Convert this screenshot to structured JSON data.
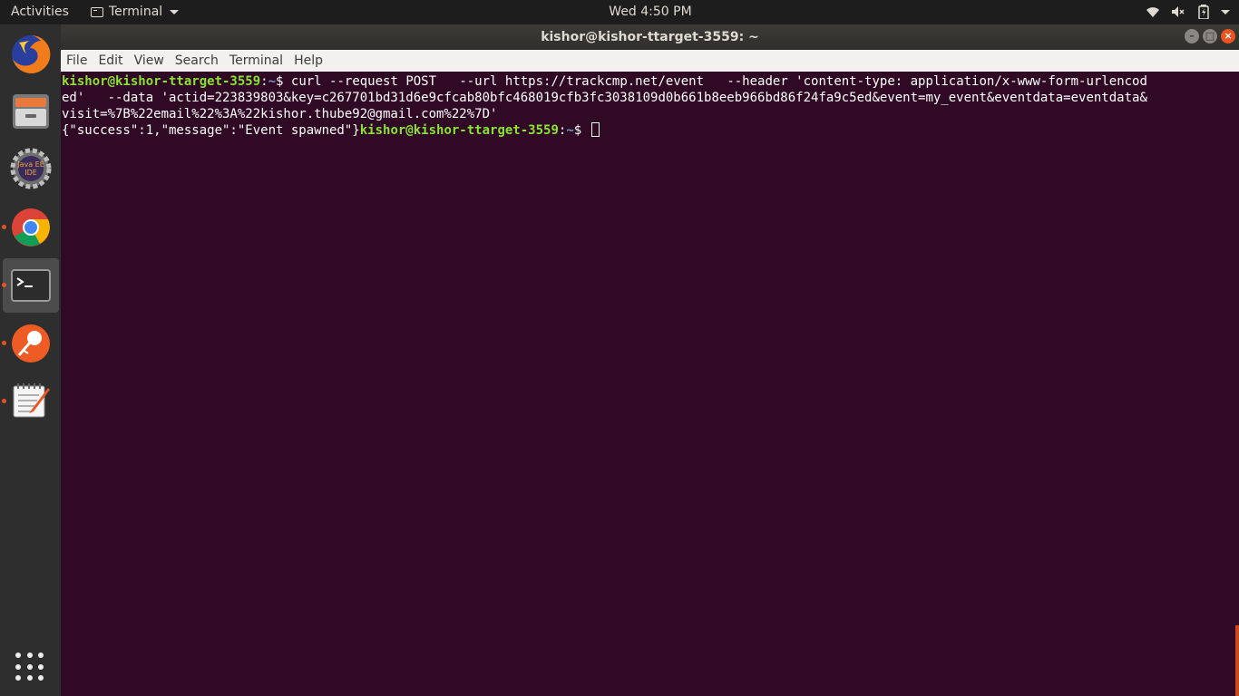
{
  "topbar": {
    "activities": "Activities",
    "app_name": "Terminal",
    "clock": "Wed  4:50 PM"
  },
  "dock": {
    "items": [
      {
        "name": "firefox",
        "running": false
      },
      {
        "name": "files",
        "running": false
      },
      {
        "name": "java-ee-ide",
        "label": "Java EE IDE",
        "running": false
      },
      {
        "name": "chrome",
        "running": true
      },
      {
        "name": "terminal",
        "running": true,
        "active": true
      },
      {
        "name": "postman",
        "running": true
      },
      {
        "name": "text-editor",
        "running": true
      }
    ]
  },
  "window": {
    "title": "kishor@kishor-ttarget-3559: ~",
    "menu": [
      "File",
      "Edit",
      "View",
      "Search",
      "Terminal",
      "Help"
    ]
  },
  "terminal": {
    "prompt_user": "kishor@kishor-ttarget-3559",
    "prompt_path": "~",
    "prompt_symbol": "$ ",
    "line1_cmd": "curl --request POST   --url https://trackcmp.net/event   --header 'content-type: application/x-www-form-urlencod",
    "line2": "ed'   --data 'actid=223839803&key=c267701bd31d6e9cfcab80bfc468019cfb3fc3038109d0b661b8eeb966bd86f24fa9c5ed&event=my_event&eventdata=eventdata&",
    "line3": "visit=%7B%22email%22%3A%22kishor.thube92@gmail.com%22%7D'",
    "line4_output": "{\"success\":1,\"message\":\"Event spawned\"}"
  },
  "colors": {
    "terminal_bg": "#300a24",
    "prompt_user": "#8ae234",
    "prompt_path": "#729fcf",
    "accent": "#e95420"
  }
}
